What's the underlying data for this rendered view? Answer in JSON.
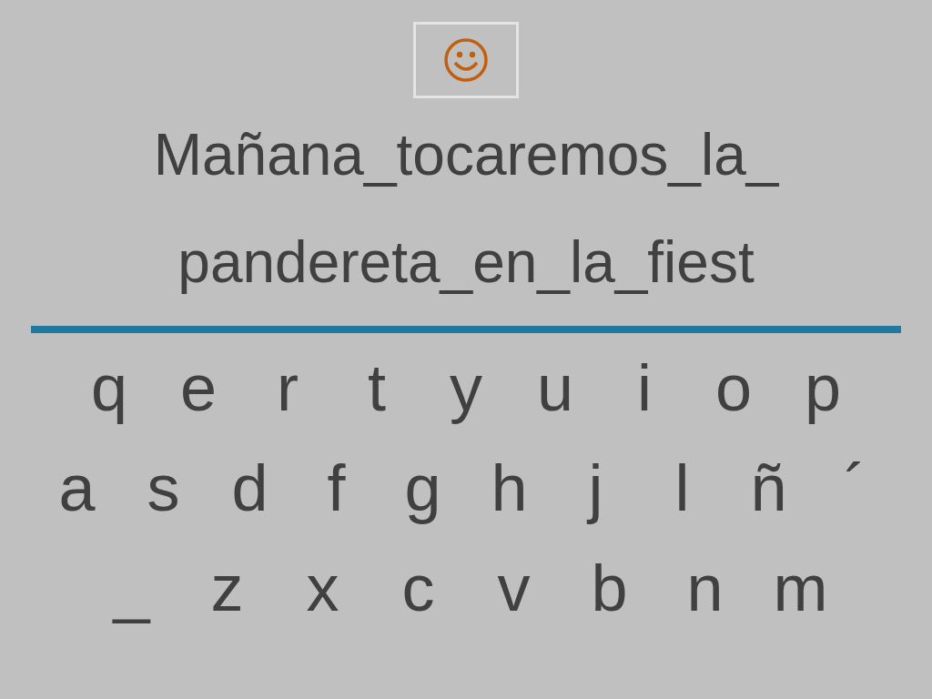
{
  "sentence_lines": [
    "Mañana_tocaremos_la_",
    "pandereta_en_la_fiest"
  ],
  "keyboard_rows": [
    [
      "q",
      "e",
      "r",
      "t",
      "y",
      "u",
      "i",
      "o",
      "p"
    ],
    [
      "a",
      "s",
      "d",
      "f",
      "g",
      "h",
      "j",
      "l",
      "ñ",
      "´"
    ],
    [
      "_",
      "z",
      "x",
      "c",
      "v",
      "b",
      "n",
      "m"
    ]
  ]
}
